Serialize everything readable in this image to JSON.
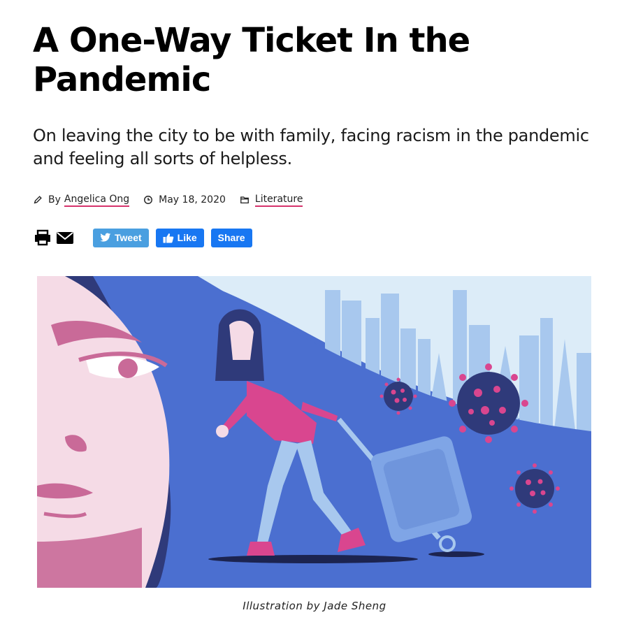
{
  "article": {
    "title": "A One-Way Ticket In the Pandemic",
    "subtitle": "On leaving the city to be with family, facing racism in the pandemic and feeling all sorts of helpless.",
    "byline_prefix": "By",
    "author": "Angelica Ong",
    "date": "May 18, 2020",
    "category": "Literature",
    "caption": "Illustration by Jade Sheng"
  },
  "share": {
    "tweet_label": "Tweet",
    "like_label": "Like",
    "share_label": "Share"
  },
  "icons": [
    "pencil-icon",
    "clock-icon",
    "folder-icon",
    "print-icon",
    "email-icon",
    "twitter-bird-icon",
    "thumbs-up-icon"
  ],
  "colors": {
    "link_underline": "#d6336c",
    "tweet_button": "#4a9fe0",
    "facebook_button": "#1877f2",
    "illustration_blue": "#4b6fd0",
    "illustration_pink": "#d9468f",
    "illustration_navy": "#2f3a7a"
  }
}
